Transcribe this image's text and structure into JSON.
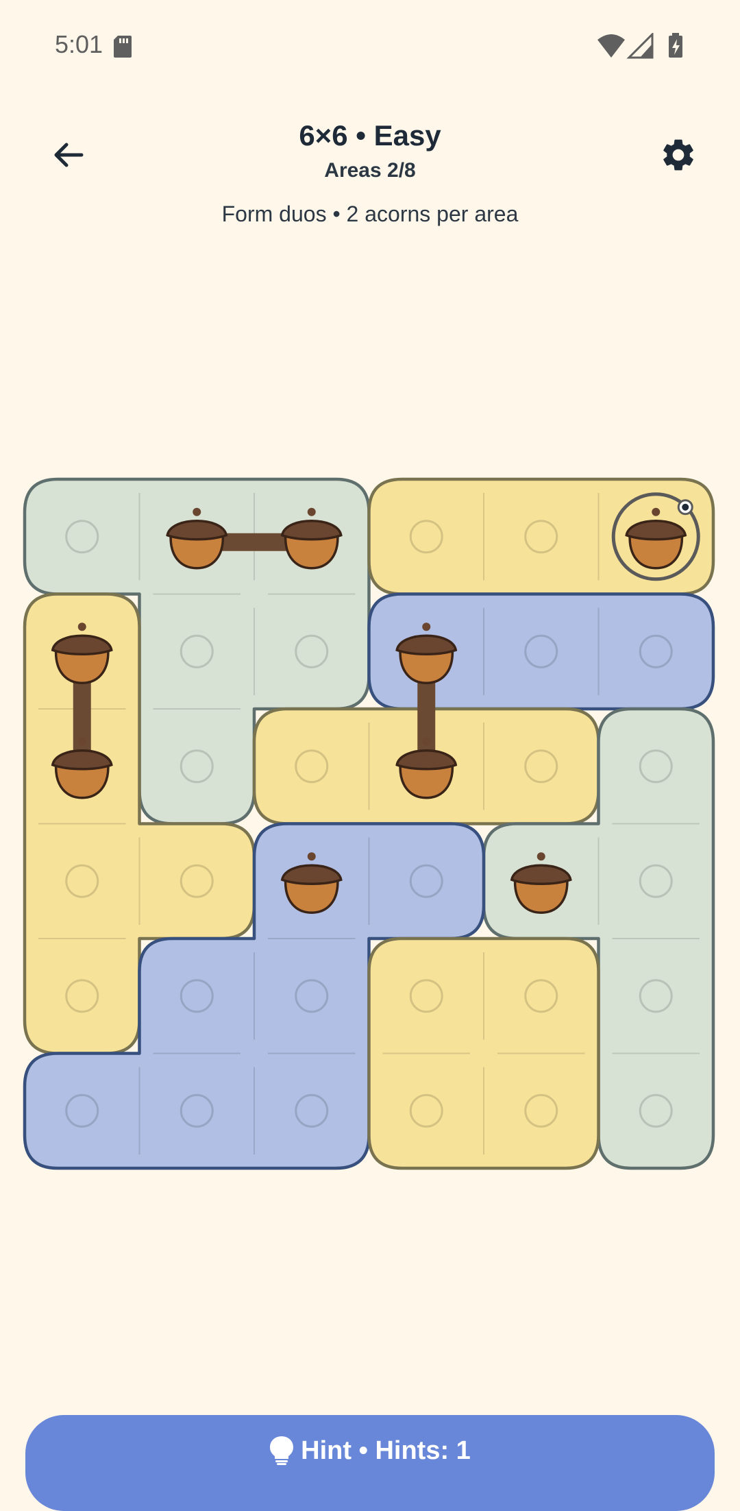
{
  "status_bar": {
    "time": "5:01",
    "icons": [
      "sd-card-icon",
      "wifi-icon",
      "cellular-signal-icon",
      "battery-charging-icon"
    ]
  },
  "header": {
    "back_icon": "arrow-back-icon",
    "title": "6×6 • Easy",
    "subtitle": "Areas 2/8",
    "settings_icon": "gear-icon"
  },
  "instructions": "Form duos • 2 acorns per area",
  "puzzle": {
    "rows": 6,
    "cols": 6,
    "colors": {
      "green_fill": "#D7E2D4",
      "green_border": "#5F6F6D",
      "yellow_fill": "#F7E299",
      "yellow_border": "#7A7350",
      "blue_fill": "#B0BFE3",
      "blue_border": "#37507E",
      "acorn_cap": "#6A4630",
      "acorn_body": "#C9823E",
      "link": "#6B4A33"
    },
    "areas": [
      {
        "id": 1,
        "color": "green",
        "cells": [
          [
            0,
            0
          ],
          [
            0,
            1
          ],
          [
            0,
            2
          ],
          [
            1,
            1
          ],
          [
            1,
            2
          ],
          [
            2,
            1
          ]
        ]
      },
      {
        "id": 2,
        "color": "yellow",
        "cells": [
          [
            0,
            3
          ],
          [
            0,
            4
          ],
          [
            0,
            5
          ]
        ]
      },
      {
        "id": 3,
        "color": "yellow",
        "cells": [
          [
            1,
            0
          ],
          [
            2,
            0
          ],
          [
            3,
            0
          ],
          [
            3,
            1
          ],
          [
            4,
            0
          ]
        ]
      },
      {
        "id": 4,
        "color": "blue",
        "cells": [
          [
            1,
            3
          ],
          [
            1,
            4
          ],
          [
            1,
            5
          ]
        ]
      },
      {
        "id": 5,
        "color": "yellow",
        "cells": [
          [
            2,
            2
          ],
          [
            2,
            3
          ],
          [
            2,
            4
          ]
        ]
      },
      {
        "id": 6,
        "color": "green",
        "cells": [
          [
            2,
            5
          ],
          [
            3,
            4
          ],
          [
            3,
            5
          ],
          [
            4,
            5
          ],
          [
            5,
            5
          ]
        ]
      },
      {
        "id": 7,
        "color": "blue",
        "cells": [
          [
            3,
            2
          ],
          [
            3,
            3
          ],
          [
            4,
            1
          ],
          [
            4,
            2
          ],
          [
            5,
            0
          ],
          [
            5,
            1
          ],
          [
            5,
            2
          ]
        ]
      },
      {
        "id": 8,
        "color": "yellow",
        "cells": [
          [
            4,
            3
          ],
          [
            4,
            4
          ],
          [
            5,
            3
          ],
          [
            5,
            4
          ]
        ]
      }
    ],
    "acorns": [
      [
        0,
        1
      ],
      [
        0,
        2
      ],
      [
        0,
        5
      ],
      [
        1,
        0
      ],
      [
        2,
        0
      ],
      [
        1,
        3
      ],
      [
        2,
        3
      ],
      [
        3,
        2
      ],
      [
        3,
        4
      ]
    ],
    "links": [
      [
        [
          0,
          1
        ],
        [
          0,
          2
        ]
      ],
      [
        [
          1,
          0
        ],
        [
          2,
          0
        ]
      ],
      [
        [
          1,
          3
        ],
        [
          2,
          3
        ]
      ]
    ],
    "selected": [
      0,
      5
    ]
  },
  "hint_button": {
    "icon": "lightbulb-icon",
    "label": "Hint • Hints: 1"
  }
}
